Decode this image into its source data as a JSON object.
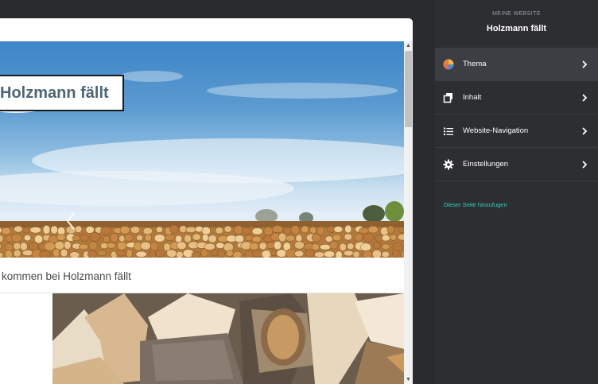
{
  "preview": {
    "site_title": "Holzmann fällt",
    "welcome_text": "kommen bei Holzmann fällt",
    "carousel_prev_icon": "chevron-left-icon",
    "scroll_up_glyph": "▲",
    "scroll_down_glyph": "▼"
  },
  "sidebar": {
    "eyebrow": "MEINE WEBSITE",
    "site_name": "Holzmann fällt",
    "items": [
      {
        "label": "Thema",
        "icon": "palette-icon",
        "active": true
      },
      {
        "label": "Inhalt",
        "icon": "pages-icon",
        "active": false
      },
      {
        "label": "Website-Navigation",
        "icon": "list-icon",
        "active": false
      },
      {
        "label": "Einstellungen",
        "icon": "gear-icon",
        "active": false
      }
    ],
    "add_link": "Dieser Seite hinzufugen"
  },
  "colors": {
    "sidebar_bg": "#2d2e32",
    "active_item_bg": "#3d3e43",
    "accent_link": "#32d3c2",
    "title_text": "#4f6575"
  }
}
